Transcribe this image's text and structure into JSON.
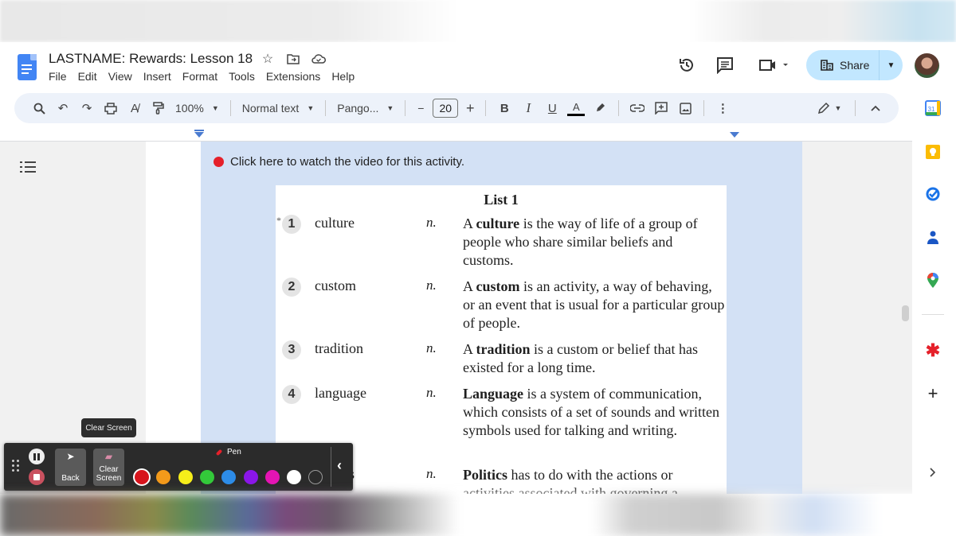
{
  "document": {
    "title": "LASTNAME: Rewards: Lesson 18",
    "title_icons": [
      "star-icon",
      "move-to-folder-icon",
      "cloud-saved-icon"
    ]
  },
  "menu": [
    "File",
    "Edit",
    "View",
    "Insert",
    "Format",
    "Tools",
    "Extensions",
    "Help"
  ],
  "header_actions": {
    "share_label": "Share",
    "share_color": "#c2e7ff",
    "icons": [
      "version-history-icon",
      "comments-icon",
      "meet-icon",
      "avatar"
    ]
  },
  "toolbar": {
    "zoom": "100%",
    "style": "Normal text",
    "font": "Pango...",
    "font_size": "20",
    "bold": "B",
    "italic": "I",
    "underline": "U",
    "text_color": "A",
    "minus": "−",
    "plus": "+",
    "more": "⋮"
  },
  "side_panel": [
    "calendar-icon",
    "keep-icon",
    "tasks-icon",
    "contacts-icon",
    "maps-icon",
    "addon-icon",
    "add-icon",
    "expand-icon"
  ],
  "content": {
    "video_link": "Click here to watch the video for this activity.",
    "list_title": "List 1",
    "entries": [
      {
        "num": "1",
        "star": "*",
        "word": "culture",
        "pos": "n.",
        "def_pre": "A ",
        "def_bold": "culture",
        "def_post": " is the way of life of a group of people who share similar beliefs and customs."
      },
      {
        "num": "2",
        "star": "",
        "word": "custom",
        "pos": "n.",
        "def_pre": "A ",
        "def_bold": "custom",
        "def_post": " is an activity, a way of behaving, or an event that is usual for a particular group of people."
      },
      {
        "num": "3",
        "star": "",
        "word": "tradition",
        "pos": "n.",
        "def_pre": "A ",
        "def_bold": "tradition",
        "def_post": " is a custom or belief that has existed for a long time."
      },
      {
        "num": "4",
        "star": "",
        "word": "language",
        "pos": "n.",
        "def_pre": "",
        "def_bold": "Language",
        "def_post": " is a system of communication, which consists of a set of sounds and written symbols used for talking and writing."
      },
      {
        "num": "",
        "star": "",
        "word": "s",
        "pos": "n.",
        "def_pre": "",
        "def_bold": "Politics",
        "def_post": " has to do with the actions or activities associated with governing a"
      }
    ]
  },
  "annotation_bar": {
    "tooltip": "Clear Screen",
    "back_label": "Back",
    "clear_label": "Clear Screen",
    "pen_label": "Pen",
    "colors": [
      "#d7141c",
      "#f39a1a",
      "#f6ee1a",
      "#33c93a",
      "#2d8ce8",
      "#8a16e8",
      "#e514b4",
      "#ffffff",
      "transparent"
    ],
    "selected_color": "#d7141c"
  }
}
